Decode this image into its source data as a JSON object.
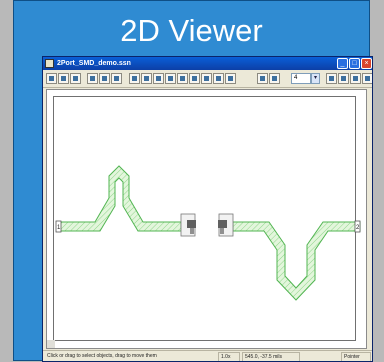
{
  "slide": {
    "title": "2D Viewer"
  },
  "window": {
    "title": "2Port_SMD_demo.ssn",
    "controls": {
      "minimize": "_",
      "maximize": "□",
      "close": "×"
    }
  },
  "toolbar": {
    "buttons": [
      "new-icon",
      "open-icon",
      "save-icon",
      "cut-icon",
      "copy-icon",
      "paste-icon",
      "select-icon",
      "pan-icon",
      "zoom-in-icon",
      "zoom-out-icon",
      "zoom-fit-icon",
      "zoom-window-icon",
      "measure-icon",
      "ruler-icon",
      "layer-icon",
      "layer-visible-icon",
      "grid-icon",
      "snap-icon",
      "properties-icon",
      "print-icon",
      "help-icon"
    ],
    "zoom_value": "4",
    "zoom_arrow": "▾"
  },
  "layout": {
    "port_1": "1",
    "port_2": "2",
    "colors": {
      "trace_fill": "#d6f2cf",
      "trace_stroke": "#52b552",
      "component_fill": "#f3f3f3"
    }
  },
  "statusbar": {
    "hint": "Click or drag to select objects, drag to move them",
    "zoom": "1.0x",
    "coords": "545.0, -37.5 mils",
    "mode": "Pointer"
  }
}
